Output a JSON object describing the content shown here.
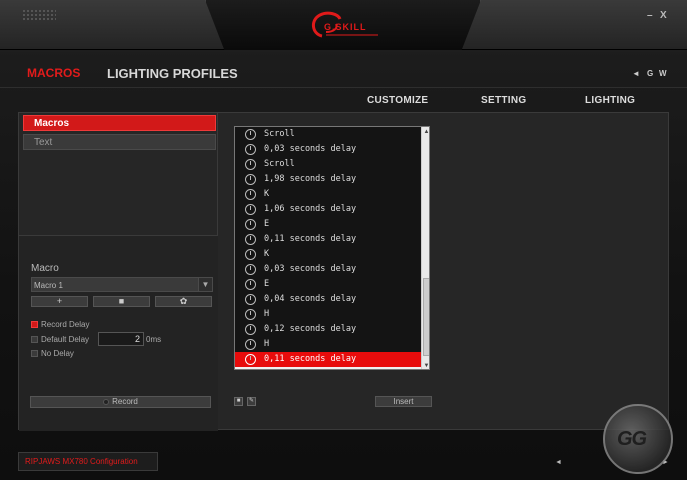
{
  "titlebar": {
    "logo_text": "G.SKILL",
    "minimize": "–",
    "close": "X"
  },
  "nav": {
    "tabs": [
      {
        "label": "MACROS",
        "active": true
      },
      {
        "label": "LIGHTING PROFILES",
        "active": false
      }
    ],
    "right": {
      "back": "◄",
      "g": "G",
      "w": "W"
    }
  },
  "subnav": {
    "items": [
      "CUSTOMIZE",
      "SETTING",
      "LIGHTING"
    ]
  },
  "left": {
    "list": [
      {
        "label": "Macros",
        "selected": true
      },
      {
        "label": "Text",
        "selected": false
      }
    ],
    "macro_panel": {
      "title": "Macro",
      "selected_macro": "Macro 1",
      "buttons": {
        "add": "+",
        "delete": "■",
        "settings": "✿"
      },
      "options": [
        {
          "label": "Record Delay",
          "checked": true
        },
        {
          "label": "Default Delay",
          "checked": false
        },
        {
          "label": "No Delay",
          "checked": false
        }
      ],
      "default_delay_value": "2",
      "default_delay_unit": "0ms",
      "record_label": "Record"
    }
  },
  "events": [
    {
      "icon": "key-up-icon",
      "text": "Scroll"
    },
    {
      "icon": "delay-clock-icon",
      "text": "0,03 seconds delay"
    },
    {
      "icon": "key-up-icon",
      "text": "Scroll"
    },
    {
      "icon": "delay-clock-icon",
      "text": "1,98 seconds delay"
    },
    {
      "icon": "key-down-icon",
      "text": "K"
    },
    {
      "icon": "delay-clock-icon",
      "text": "1,06 seconds delay"
    },
    {
      "icon": "key-down-icon",
      "text": "E"
    },
    {
      "icon": "delay-clock-icon",
      "text": "0,11 seconds delay"
    },
    {
      "icon": "key-up-icon",
      "text": "K"
    },
    {
      "icon": "delay-clock-icon",
      "text": "0,03 seconds delay"
    },
    {
      "icon": "key-up-icon",
      "text": "E"
    },
    {
      "icon": "delay-clock-icon",
      "text": "0,04 seconds delay"
    },
    {
      "icon": "key-down-icon",
      "text": "H"
    },
    {
      "icon": "delay-clock-icon",
      "text": "0,12 seconds delay"
    },
    {
      "icon": "key-up-icon",
      "text": "H"
    },
    {
      "icon": "delay-clock-icon",
      "text": "0,11 seconds delay",
      "selected": true
    }
  ],
  "events_toolbar": {
    "square": "■",
    "edit": "✎",
    "insert_label": "Insert"
  },
  "footer": {
    "config_label": "RIPJAWS MX780 Configuration",
    "prev": "◄",
    "next": "►"
  },
  "watermark_text": "GG",
  "colors": {
    "accent": "#e21b1b",
    "selected_row": "#e80c0c"
  }
}
